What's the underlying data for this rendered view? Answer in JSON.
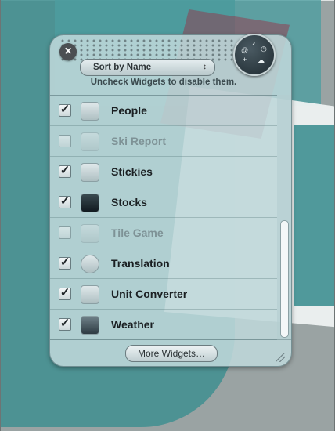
{
  "panel": {
    "sort_label": "Sort by Name",
    "sort_arrows": "↕",
    "hint": "Uncheck Widgets to disable them.",
    "more_button": "More Widgets…"
  },
  "widgets": [
    {
      "name": "People",
      "enabled": true,
      "icon": "people-icon"
    },
    {
      "name": "Ski Report",
      "enabled": false,
      "icon": "snowflake-icon"
    },
    {
      "name": "Stickies",
      "enabled": true,
      "icon": "stickies-icon"
    },
    {
      "name": "Stocks",
      "enabled": true,
      "icon": "stocks-icon"
    },
    {
      "name": "Tile Game",
      "enabled": false,
      "icon": "tile-game-icon"
    },
    {
      "name": "Translation",
      "enabled": true,
      "icon": "globe-icon"
    },
    {
      "name": "Unit Converter",
      "enabled": true,
      "icon": "unit-converter-icon"
    },
    {
      "name": "Weather",
      "enabled": true,
      "icon": "weather-icon"
    }
  ],
  "check_glyph": "✓",
  "close_glyph": "×"
}
